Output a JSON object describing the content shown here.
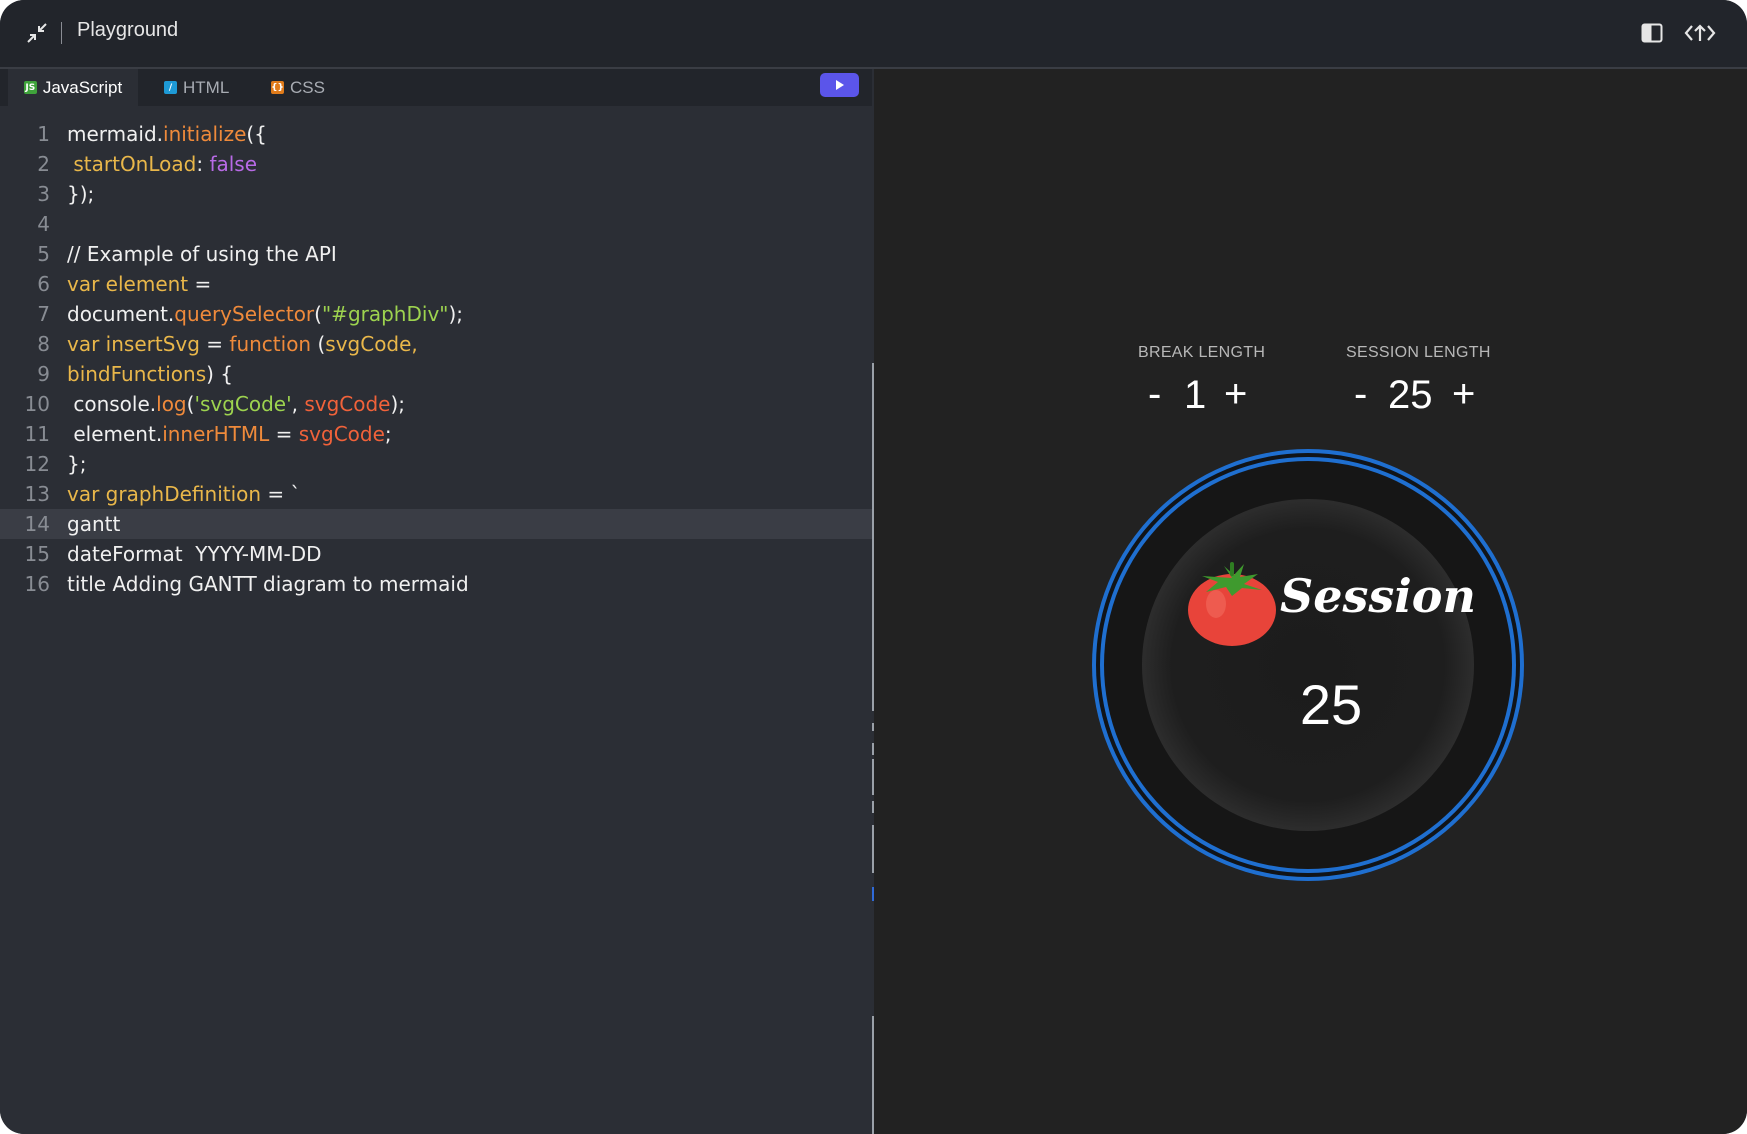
{
  "titlebar": {
    "title": "Playground",
    "icons": [
      "collapse-icon",
      "panel-toggle-icon",
      "share-icon"
    ]
  },
  "tabs": [
    {
      "label": "JavaScript",
      "icon": "js-icon",
      "icon_text": "JS",
      "color": "#3fa33b",
      "active": true
    },
    {
      "label": "HTML",
      "icon": "html-icon",
      "icon_text": "/",
      "color": "#1e9ad6",
      "active": false
    },
    {
      "label": "CSS",
      "icon": "css-icon",
      "icon_text": "{}",
      "color": "#e07b1a",
      "active": false
    }
  ],
  "run_button": {
    "icon": "play-icon",
    "color": "#5b55ea"
  },
  "code": {
    "current_line": 14,
    "lines": [
      {
        "n": "1",
        "tokens": [
          [
            "w",
            "mermaid."
          ],
          [
            "o",
            "initialize"
          ],
          [
            "w",
            "({"
          ]
        ]
      },
      {
        "n": "2",
        "tokens": [
          [
            "w",
            " "
          ],
          [
            "y",
            "startOnLoad"
          ],
          [
            "w",
            ": "
          ],
          [
            "p",
            "false"
          ]
        ]
      },
      {
        "n": "3",
        "tokens": [
          [
            "w",
            "});"
          ]
        ]
      },
      {
        "n": "4",
        "tokens": []
      },
      {
        "n": "5",
        "tokens": [
          [
            "w",
            "// Example of using the API"
          ]
        ]
      },
      {
        "n": "6",
        "tokens": [
          [
            "y",
            "var element"
          ],
          [
            "w",
            " ="
          ]
        ]
      },
      {
        "n": "7",
        "tokens": [
          [
            "w",
            "document."
          ],
          [
            "o",
            "querySelector"
          ],
          [
            "w",
            "("
          ],
          [
            "g",
            "\"#graphDiv\""
          ],
          [
            "w",
            ");"
          ]
        ]
      },
      {
        "n": "8",
        "tokens": [
          [
            "y",
            "var insertSvg"
          ],
          [
            "w",
            " = "
          ],
          [
            "o",
            "function"
          ],
          [
            "w",
            " ("
          ],
          [
            "y",
            "svgCode,"
          ]
        ]
      },
      {
        "n": "9",
        "tokens": [
          [
            "y",
            "bindFunctions"
          ],
          [
            "w",
            ") {"
          ]
        ]
      },
      {
        "n": "10",
        "tokens": [
          [
            "w",
            " console."
          ],
          [
            "o",
            "log"
          ],
          [
            "w",
            "("
          ],
          [
            "g",
            "'svgCode'"
          ],
          [
            "w",
            ", "
          ],
          [
            "r",
            "svgCode"
          ],
          [
            "w",
            ");"
          ]
        ]
      },
      {
        "n": "11",
        "tokens": [
          [
            "w",
            " element."
          ],
          [
            "o",
            "innerHTML"
          ],
          [
            "w",
            " = "
          ],
          [
            "r",
            "svgCode"
          ],
          [
            "w",
            ";"
          ]
        ]
      },
      {
        "n": "12",
        "tokens": [
          [
            "w",
            "};"
          ]
        ]
      },
      {
        "n": "13",
        "tokens": [
          [
            "y",
            "var graphDefinition"
          ],
          [
            "w",
            " = `"
          ]
        ]
      },
      {
        "n": "14",
        "tokens": [
          [
            "w",
            "gantt"
          ]
        ]
      },
      {
        "n": "15",
        "tokens": [
          [
            "w",
            "dateFormat  YYYY-MM-DD"
          ]
        ]
      },
      {
        "n": "16",
        "tokens": [
          [
            "w",
            "title Adding GANTT diagram to mermaid"
          ]
        ]
      }
    ]
  },
  "preview": {
    "break_label": "BREAK LENGTH",
    "break_value": "1",
    "session_label": "SESSION LENGTH",
    "session_value": "25",
    "minus": "-",
    "plus": "+",
    "clock_label": "Session",
    "timer": "25",
    "tomato_icon": "tomato-icon",
    "ring_color": "#1f6fd0"
  }
}
